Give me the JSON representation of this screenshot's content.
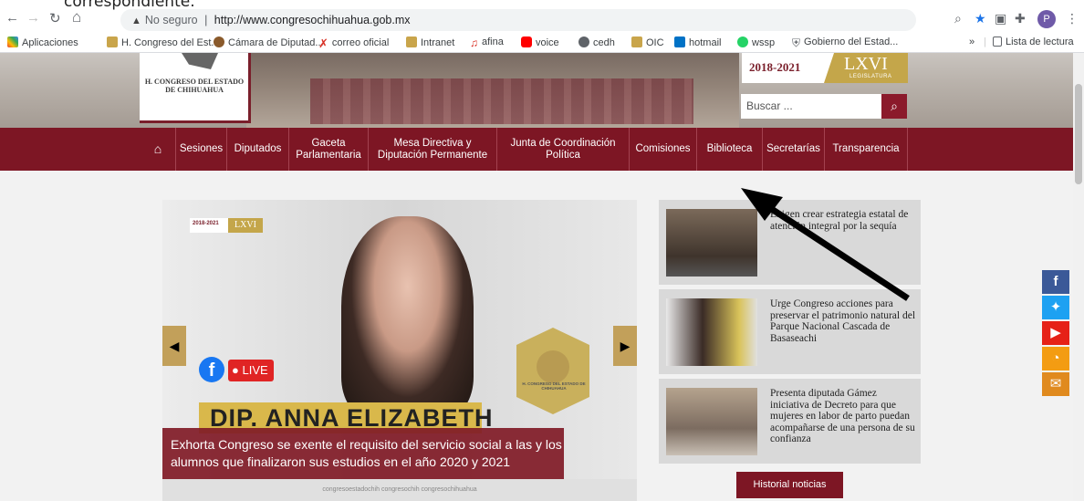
{
  "top_crop_text": "correspondiente.",
  "browser": {
    "address": {
      "insecure_label": "No seguro",
      "url": "http://www.congresochihuahua.gob.mx"
    },
    "profile_initial": "P",
    "bookmarks": [
      "Aplicaciones",
      "H. Congreso del Est...",
      "Cámara de Diputad...",
      "correo oficial",
      "Intranet",
      "afina",
      "voice",
      "cedh",
      "OIC",
      "hotmail",
      "wssp",
      "Gobierno del Estad..."
    ],
    "more_bookmarks": "»",
    "reading_list": "Lista de lectura"
  },
  "site": {
    "logo_text": "H. CONGRESO DEL ESTADO DE CHIHUAHUA",
    "legislature_years": "2018-2021",
    "legislature_number": "LXVI",
    "legislature_sub": "LEGISLATURA",
    "search_placeholder": "Buscar ...",
    "menu": [
      "Sesiones",
      "Diputados",
      "Gaceta Parlamentaria",
      "Mesa Directiva y Diputación Permanente",
      "Junta de Coordinación Política",
      "Comisiones",
      "Biblioteca",
      "Secretarías",
      "Transparencia"
    ]
  },
  "slider": {
    "badge_years": "2018-2021",
    "badge_number": "LXVI",
    "live_label": "LIVE",
    "seal_text": "H. CONGRESO DEL ESTADO DE CHIHUAHUA",
    "name_text": "DIP. ANNA ELIZABETH",
    "caption": "Exhorta Congreso se exente el requisito del servicio social a las y los alumnos que finalizaron sus estudios en el año 2020 y 2021",
    "footer": "congresoestadochih   congresochih   congresochihuahua"
  },
  "news": [
    {
      "title": "Exigen crear estrategia estatal de atención integral por la sequía"
    },
    {
      "title": "Urge Congreso acciones para preservar el patrimonio natural del Parque Nacional Cascada de Basaseachi"
    },
    {
      "title": "Presenta diputada Gámez iniciativa de Decreto para que mujeres en labor de parto puedan acompañarse de una persona de su confianza"
    }
  ],
  "historial_label": "Historial noticias",
  "colors": {
    "brand": "#7d1624",
    "gold": "#c4a64a",
    "facebook": "#3b5998",
    "twitter": "#1da1f2",
    "youtube": "#e62117",
    "rss": "#f39c12",
    "mail": "#e08a1e"
  },
  "social_icons": [
    "facebook-icon",
    "twitter-icon",
    "youtube-icon",
    "rss-icon",
    "mail-icon"
  ]
}
